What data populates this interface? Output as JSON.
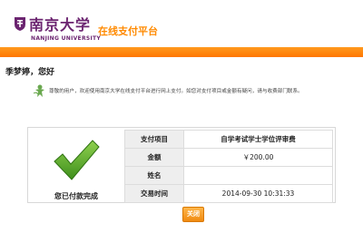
{
  "header": {
    "logo_cn": "南京大学",
    "logo_en": "NANJING UNIVERSITY",
    "platform_title": "在线支付平台",
    "accent_color": "#ff8a00",
    "logo_color": "#6b2470",
    "logo_icon": "university-emblem-icon"
  },
  "greeting": "季梦婷，您好",
  "welcome": {
    "icon": "welcome-figure-icon",
    "text": "尊敬的用户，欢迎使用南京大学在线支付平台进行网上支付。如您对支付项目或金额有疑问，请与收费部门联系。"
  },
  "payment": {
    "status_icon": "green-check-icon",
    "status_text": "您已付款完成",
    "rows": [
      {
        "label": "支付项目",
        "value": "自学考试学士学位评审费"
      },
      {
        "label": "金额",
        "value": "￥200.00"
      },
      {
        "label": "姓名",
        "value": ""
      },
      {
        "label": "交易时间",
        "value": "2014-09-30 10:31:33"
      }
    ]
  },
  "close_button": "关闭"
}
